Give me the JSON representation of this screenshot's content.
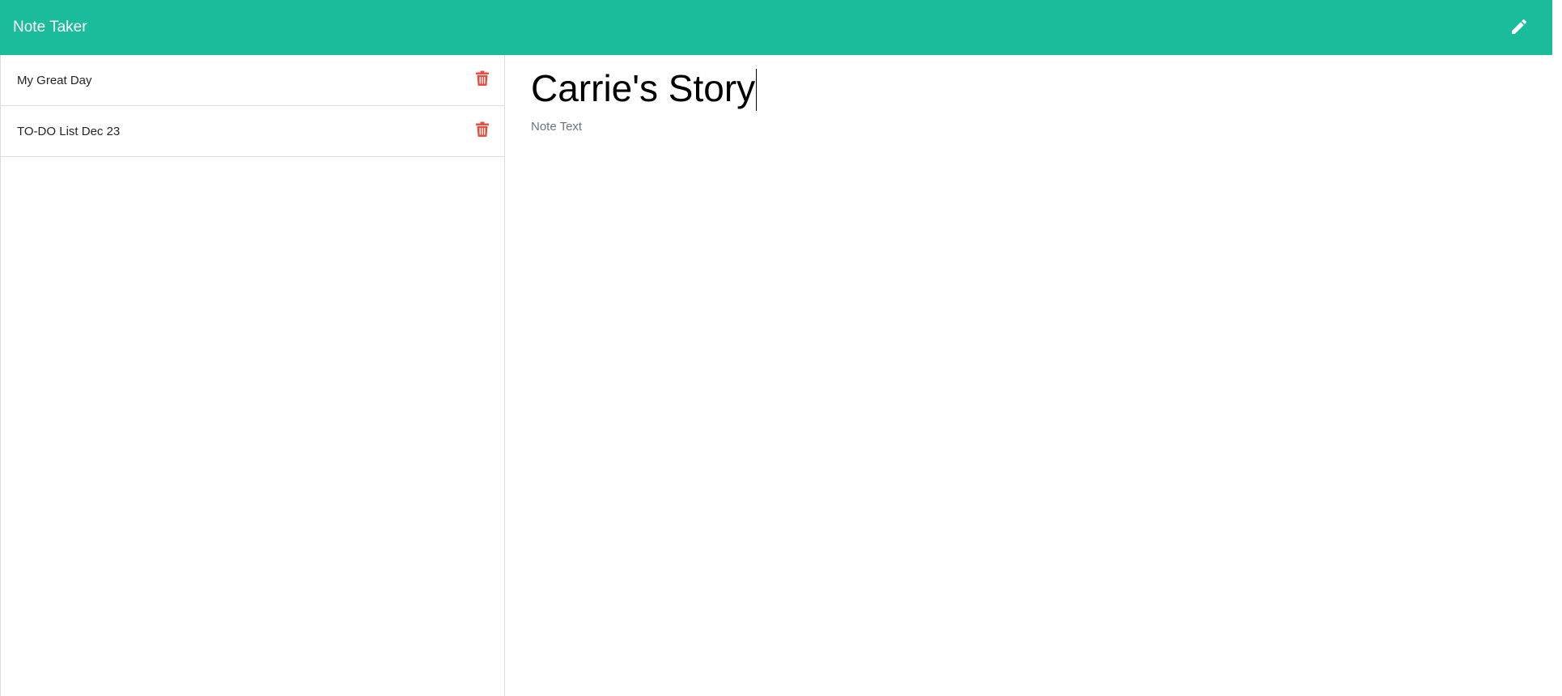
{
  "navbar": {
    "brand": "Note Taker",
    "new_note_icon": "pencil-icon",
    "background_color": "#1abc9c"
  },
  "sidebar": {
    "notes": [
      {
        "title": "My Great Day",
        "delete_icon": "trash-icon"
      },
      {
        "title": "TO-DO List Dec 23",
        "delete_icon": "trash-icon"
      }
    ],
    "delete_color": "#e74c3c"
  },
  "editor": {
    "title_value": "Carrie's Story",
    "text_value": "",
    "text_placeholder": "Note Text"
  }
}
